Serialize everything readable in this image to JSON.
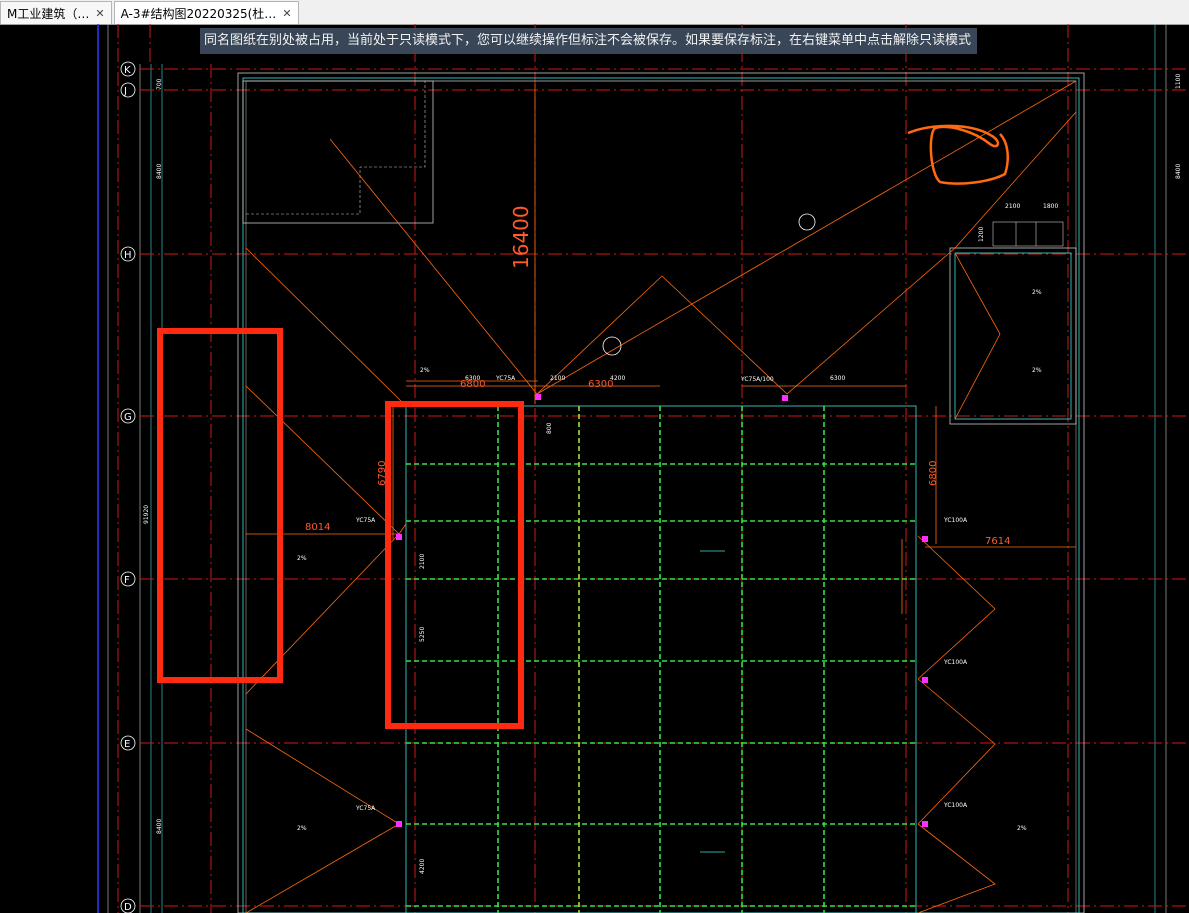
{
  "tabs": [
    {
      "label": "M工业建筑（…",
      "close": "✕"
    },
    {
      "label": "A-3#结构图20220325(杜…",
      "close": "✕"
    }
  ],
  "notice": "同名图纸在别处被占用，当前处于只读模式下，您可以继续操作但标注不会被保存。如果要保存标注，在右键菜单中点击解除只读模式",
  "axes": {
    "K": "K",
    "J": "J",
    "H": "H",
    "G": "G",
    "F": "F",
    "E": "E",
    "D": "D"
  },
  "dims": {
    "d16400": "16400",
    "d6800_top": "6800",
    "d6300_a": "6300",
    "d2100": "2100",
    "d6300_b": "6300",
    "d4200": "4200",
    "d6300_c": "6300",
    "d6790": "6790",
    "d8014": "8014",
    "d6800_right": "6800",
    "d7614": "7614",
    "d2100_box": "2100",
    "d1800_box": "1800",
    "d1200": "1200",
    "d2100_v": "2100",
    "d5250": "5250",
    "d4200_v": "4200",
    "d8400_a": "8400",
    "d8400_b": "8400",
    "d8400_c": "8400",
    "d91920": "91920",
    "d1100": "1100",
    "d700": "700",
    "d800": "800"
  },
  "labels": {
    "yc75a_1": "YC75A",
    "yc75a_2": "YC75A",
    "yc75a_3": "YC75A",
    "yc100a_1": "YC100A",
    "yc100a_2": "YC100A",
    "yc100a_3": "YC100A",
    "yc75_100": "YC75A/100",
    "slope": "2%"
  },
  "colors": {
    "annotation_red": "#ff2a10",
    "accent_orange": "#ff6a10",
    "grid_green": "#35e04a",
    "cyan": "#40e0e0"
  }
}
